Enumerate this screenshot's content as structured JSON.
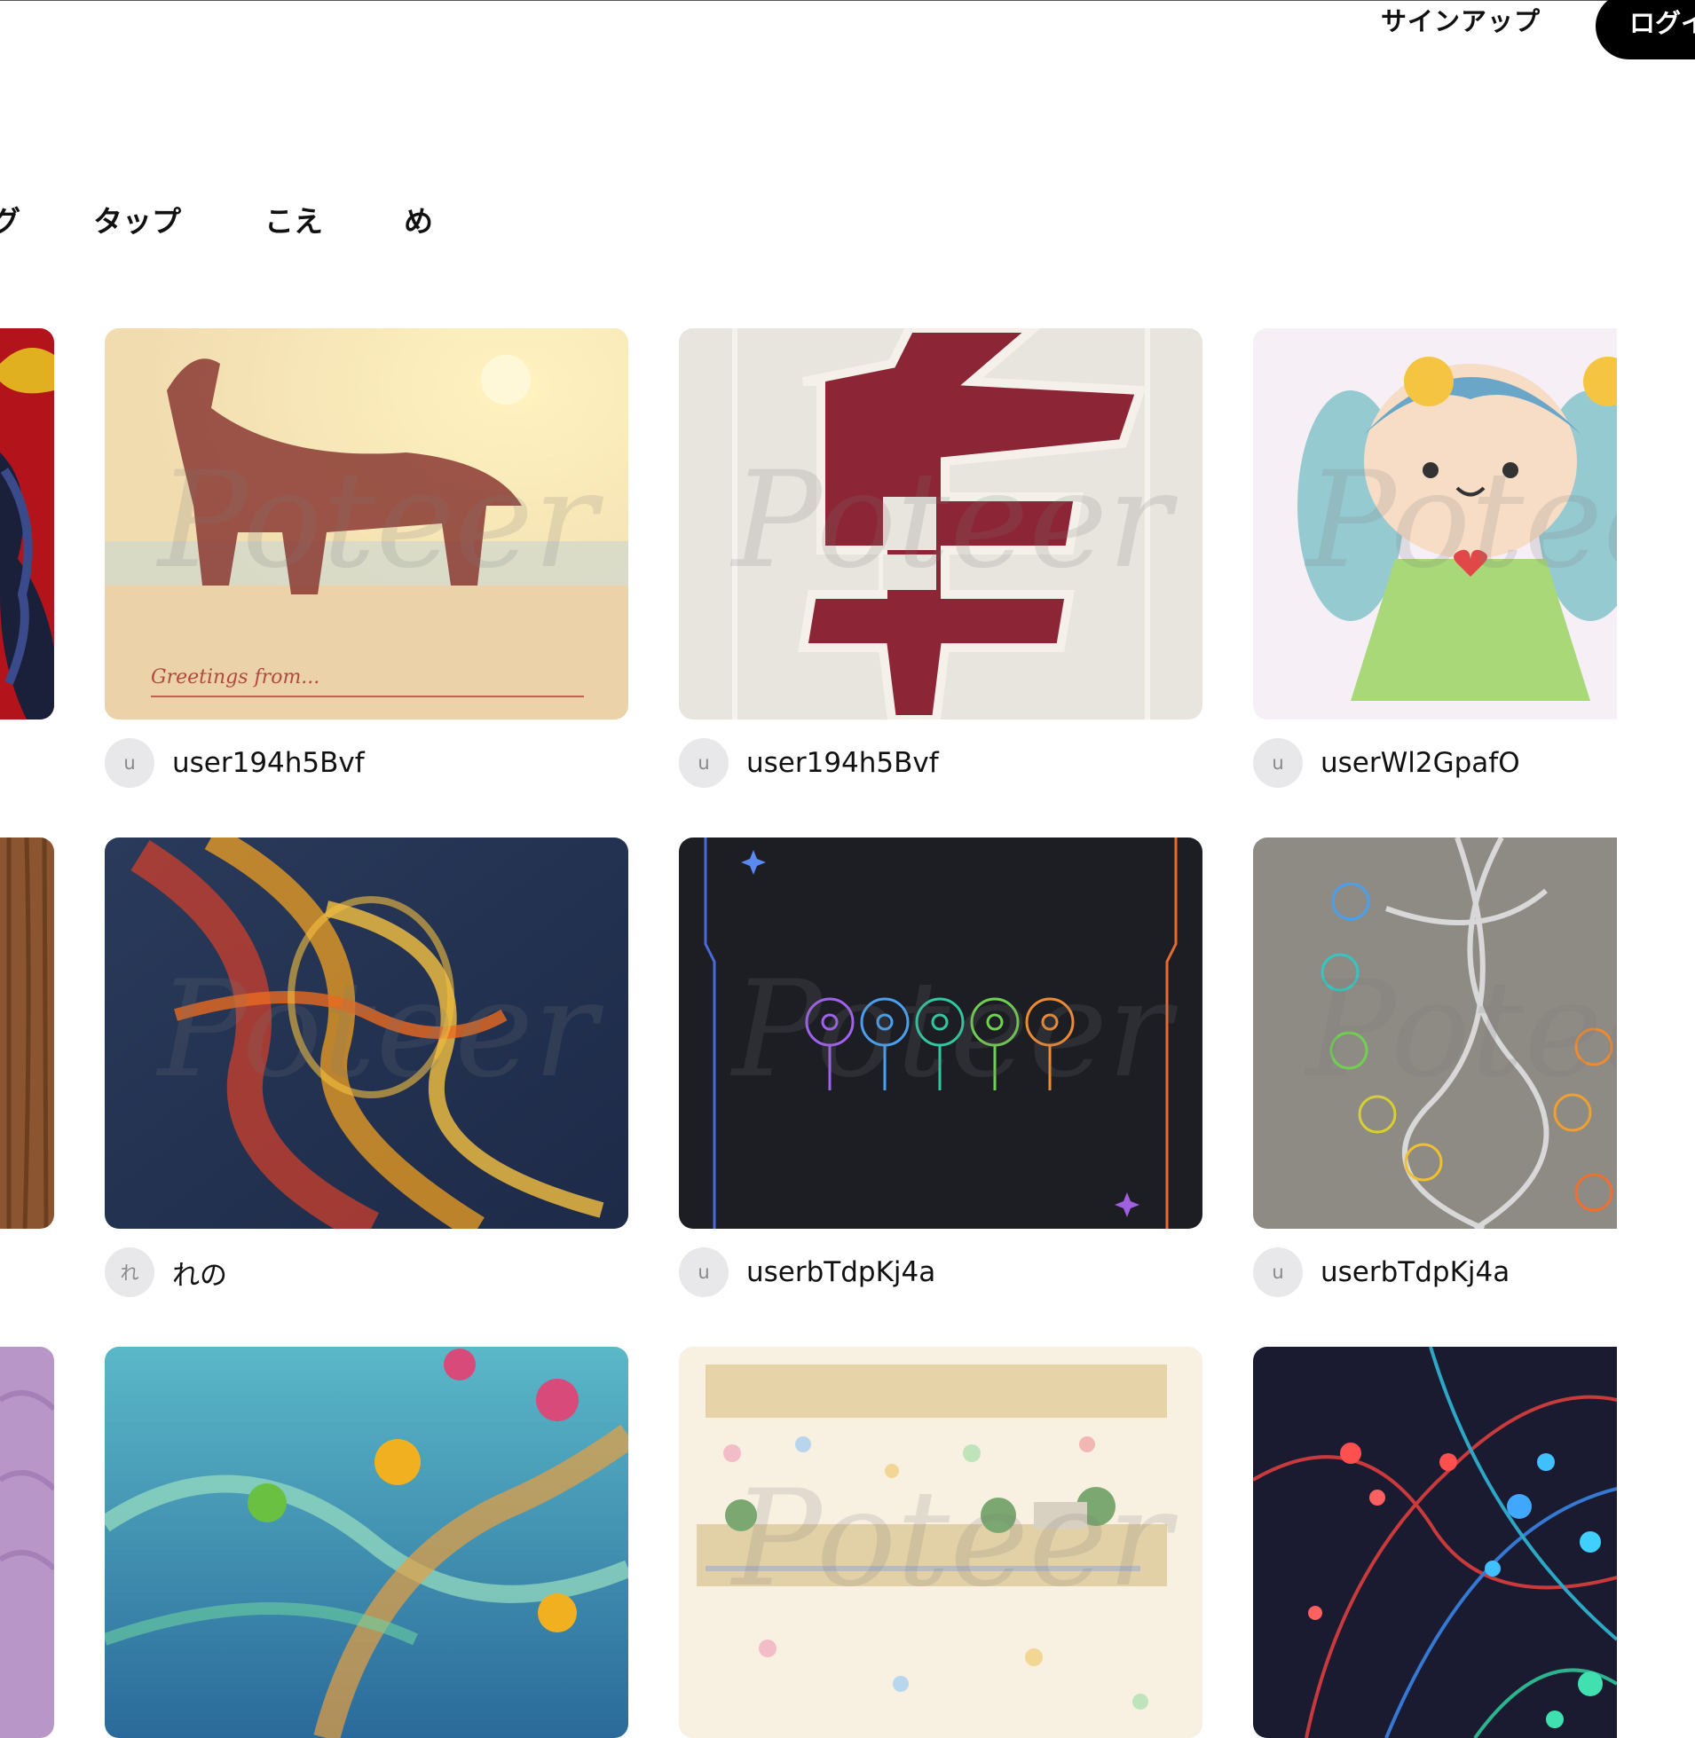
{
  "header": {
    "signup_label": "サインアップ",
    "login_label": "ログイ"
  },
  "tabs": [
    {
      "label": "グ"
    },
    {
      "label": "タップ"
    },
    {
      "label": "こえ"
    },
    {
      "label": "め"
    }
  ],
  "watermark": "Poteer",
  "cards": [
    {
      "username": "user194h5Bvf",
      "avatar": "u",
      "caption": "Greetings from..."
    },
    {
      "username": "user194h5Bvf",
      "avatar": "u"
    },
    {
      "username": "userWl2GpafO",
      "avatar": "u"
    },
    {
      "username": "れの",
      "avatar": "れ"
    },
    {
      "username": "userbTdpKj4a",
      "avatar": "u"
    },
    {
      "username": "userbTdpKj4a",
      "avatar": "u"
    },
    {
      "username": "",
      "avatar": ""
    },
    {
      "username": "",
      "avatar": ""
    },
    {
      "username": "",
      "avatar": ""
    }
  ],
  "colors": {
    "login_bg": "#000000",
    "avatar_bg": "#e8e8ea"
  }
}
